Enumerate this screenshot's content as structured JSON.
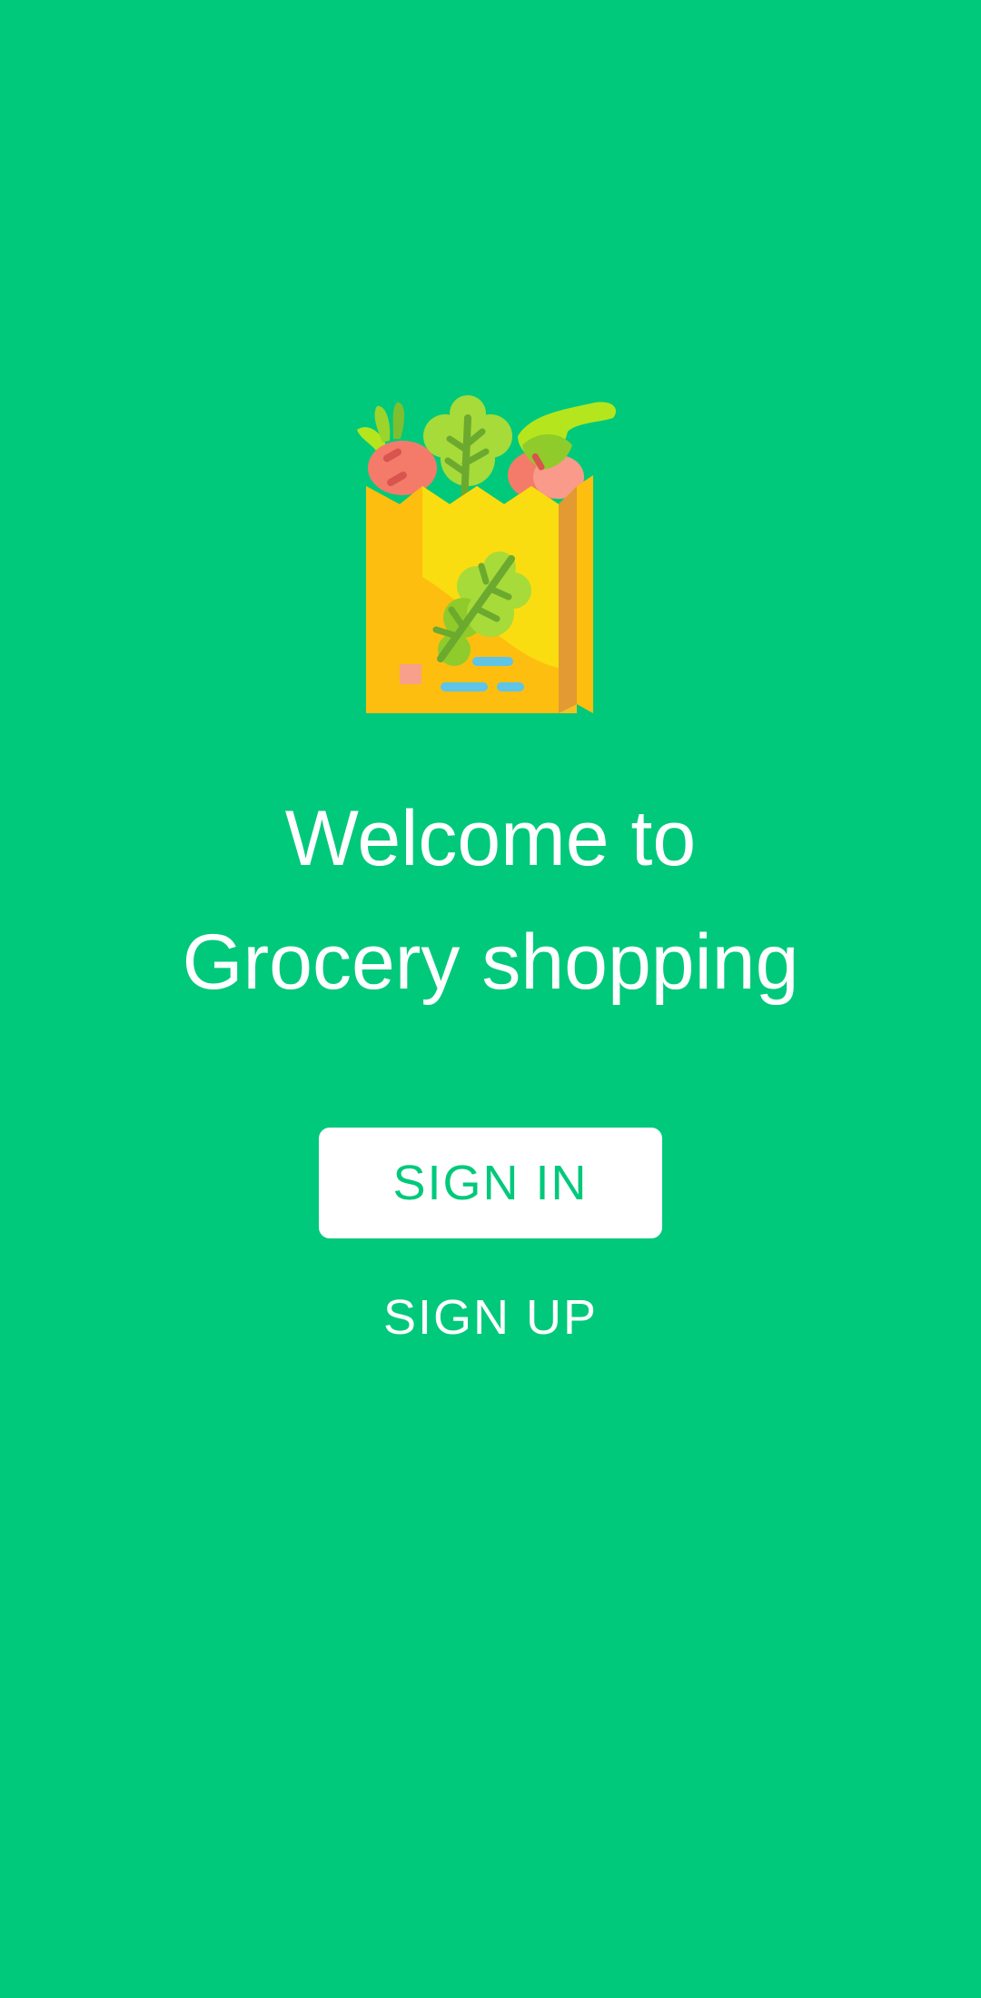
{
  "app": {
    "logo_icon": "grocery-bag-icon",
    "background_color": "#00C97B",
    "accent_color": "#00C97B"
  },
  "welcome": {
    "line1": "Welcome to",
    "line2": "Grocery shopping"
  },
  "actions": {
    "signin_label": "SIGN IN",
    "signup_label": "SIGN UP"
  }
}
